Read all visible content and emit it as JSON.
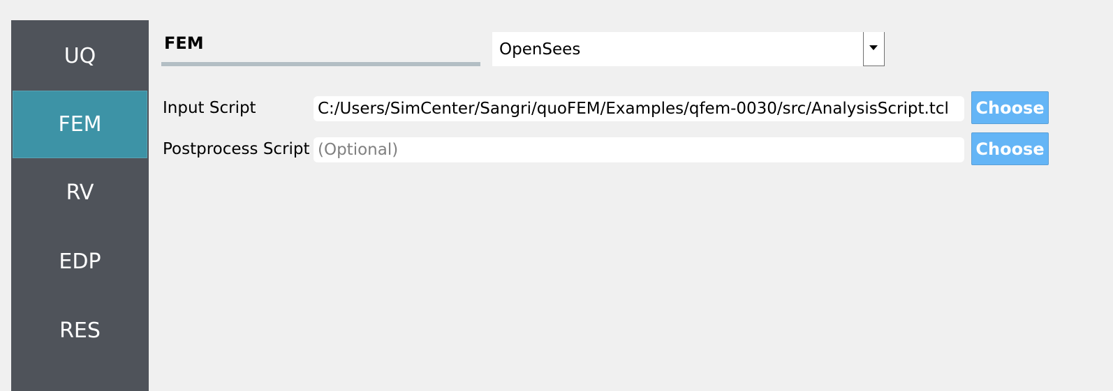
{
  "sidebar": {
    "items": [
      {
        "label": "UQ",
        "active": false
      },
      {
        "label": "FEM",
        "active": true
      },
      {
        "label": "RV",
        "active": false
      },
      {
        "label": "EDP",
        "active": false
      },
      {
        "label": "RES",
        "active": false
      }
    ]
  },
  "main": {
    "section_title": "FEM",
    "application_select": {
      "value": "OpenSees"
    },
    "input_script": {
      "label": "Input Script",
      "value": "C:/Users/SimCenter/Sangri/quoFEM/Examples/qfem-0030/src/AnalysisScript.tcl",
      "button_label": "Choose"
    },
    "postprocess_script": {
      "label": "Postprocess Script",
      "placeholder": "(Optional)",
      "value": "",
      "button_label": "Choose"
    }
  },
  "colors": {
    "sidebar_bg": "#4f535a",
    "sidebar_active": "#3d93a6",
    "button_bg": "#64b5f6",
    "page_bg": "#f0f0f0",
    "underline": "#b3bec4"
  }
}
